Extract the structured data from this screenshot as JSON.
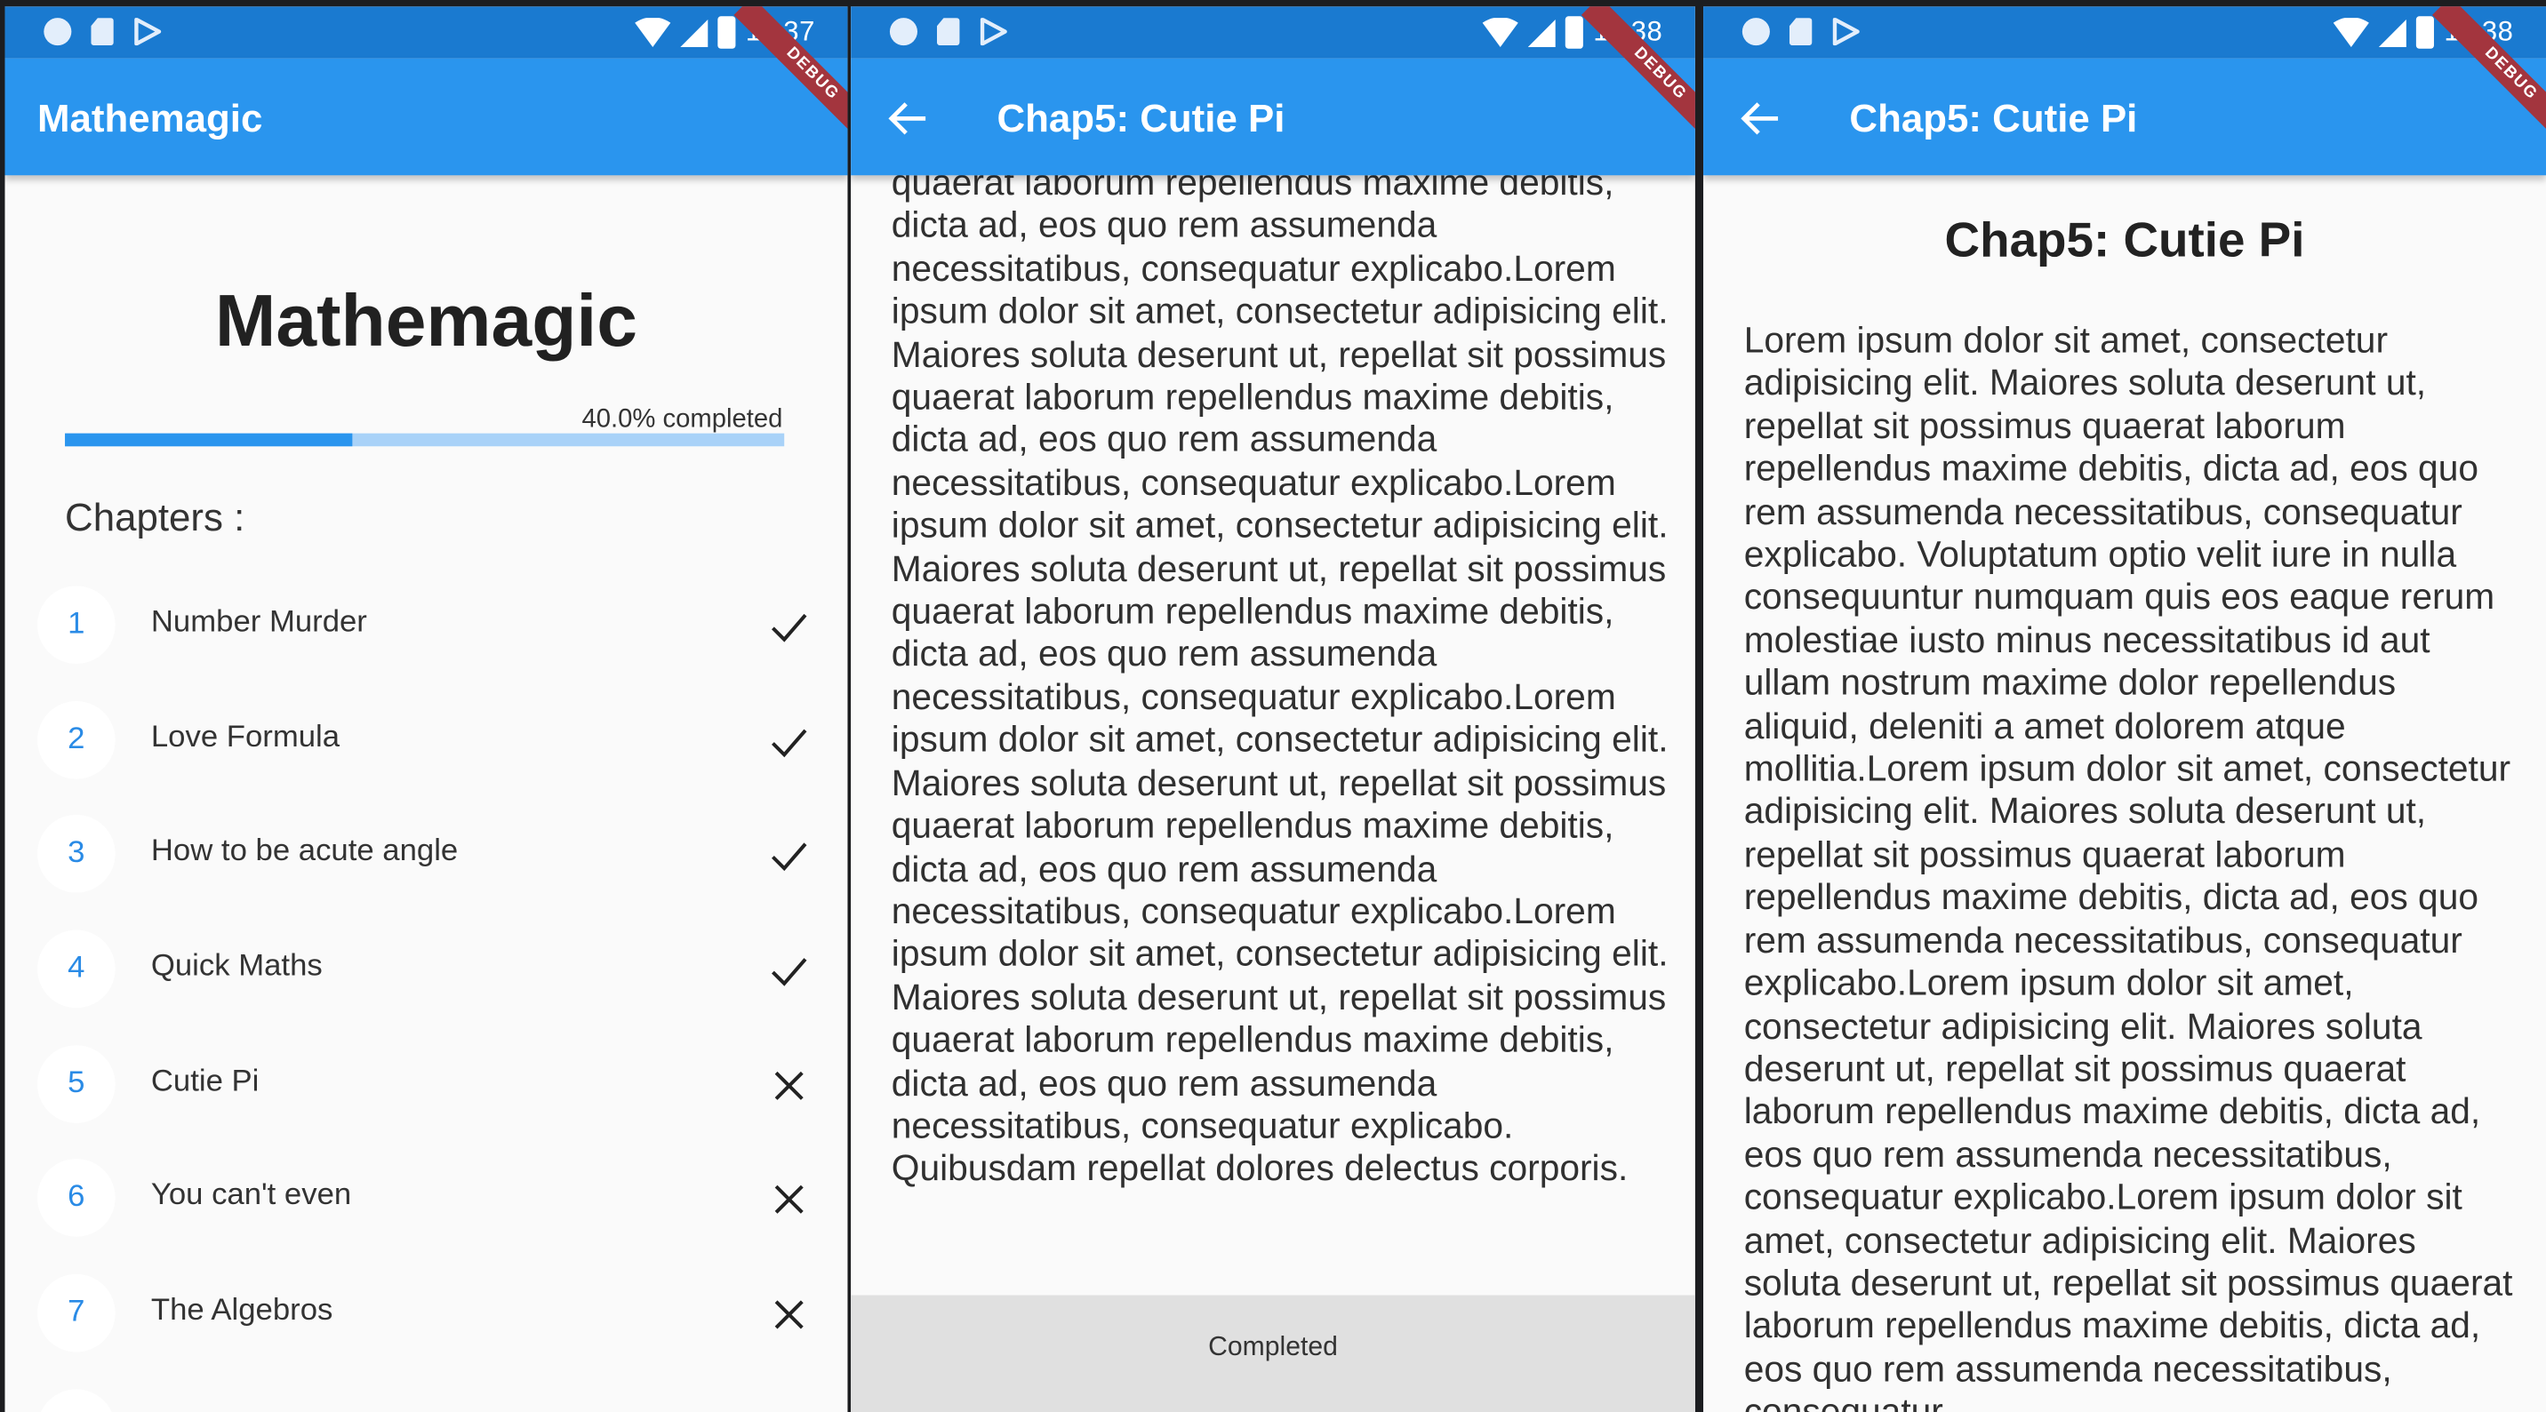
{
  "statusbar": {
    "time_1": "11:37",
    "time_2": "11:38",
    "time_3": "11:38"
  },
  "debug_banner": "DEBUG",
  "home": {
    "appbar_title": "Mathemagic",
    "title": "Mathemagic",
    "progress_label": "40.0% completed",
    "progress_fraction": 0.4,
    "chapters_label": "Chapters :",
    "chapters": [
      {
        "num": "1",
        "title": "Number Murder",
        "status": "check-icon"
      },
      {
        "num": "2",
        "title": "Love Formula",
        "status": "check-icon"
      },
      {
        "num": "3",
        "title": "How to be acute angle",
        "status": "check-icon"
      },
      {
        "num": "4",
        "title": "Quick Maths",
        "status": "check-icon"
      },
      {
        "num": "5",
        "title": "Cutie Pi",
        "status": "close-icon"
      },
      {
        "num": "6",
        "title": "You can't even",
        "status": "close-icon"
      },
      {
        "num": "7",
        "title": "The Algebros",
        "status": "close-icon"
      }
    ]
  },
  "reader": {
    "appbar_title": "Chap5: Cutie Pi",
    "text": "quaerat laborum repellendus maxime debitis, dicta ad, eos quo rem assumenda necessitatibus, consequatur explicabo.Lorem ipsum dolor sit amet, consectetur adipisicing elit. Maiores soluta deserunt ut, repellat sit possimus quaerat laborum repellendus maxime debitis, dicta ad, eos quo rem assumenda necessitatibus, consequatur explicabo.Lorem ipsum dolor sit amet, consectetur adipisicing elit. Maiores soluta deserunt ut, repellat sit possimus quaerat laborum repellendus maxime debitis, dicta ad, eos quo rem assumenda necessitatibus, consequatur explicabo.Lorem ipsum dolor sit amet, consectetur adipisicing elit. Maiores soluta deserunt ut, repellat sit possimus quaerat laborum repellendus maxime debitis, dicta ad, eos quo rem assumenda necessitatibus, consequatur explicabo.Lorem ipsum dolor sit amet, consectetur adipisicing elit. Maiores soluta deserunt ut, repellat sit possimus quaerat laborum repellendus maxime debitis, dicta ad, eos quo rem assumenda necessitatibus, consequatur explicabo. Quibusdam repellat dolores delectus corporis.",
    "completed_button": "Completed"
  },
  "chapter": {
    "appbar_title": "Chap5: Cutie Pi",
    "heading": "Chap5: Cutie Pi",
    "body": "Lorem ipsum dolor sit amet, consectetur adipisicing elit. Maiores soluta deserunt ut, repellat sit possimus quaerat laborum repellendus maxime debitis, dicta ad, eos quo rem assumenda necessitatibus, consequatur explicabo. Voluptatum optio velit iure in nulla consequuntur numquam quis eos eaque rerum molestiae iusto minus necessitatibus id aut ullam nostrum maxime dolor repellendus aliquid, deleniti a amet dolorem atque mollitia.Lorem ipsum dolor sit amet, consectetur adipisicing elit. Maiores soluta deserunt ut, repellat sit possimus quaerat laborum repellendus maxime debitis, dicta ad, eos quo rem assumenda necessitatibus, consequatur explicabo.Lorem ipsum dolor sit amet, consectetur adipisicing elit. Maiores soluta deserunt ut, repellat sit possimus quaerat laborum repellendus maxime debitis, dicta ad, eos quo rem assumenda necessitatibus, consequatur explicabo.Lorem ipsum dolor sit amet, consectetur adipisicing elit. Maiores soluta deserunt ut, repellat sit possimus quaerat laborum repellendus maxime debitis, dicta ad, eos quo rem assumenda necessitatibus, consequatur"
  },
  "colors": {
    "appbar": "#2a95ee",
    "statusbar": "#1a7ad0",
    "progress_track": "#a9d2f8",
    "debug_banner": "#a3353e"
  }
}
